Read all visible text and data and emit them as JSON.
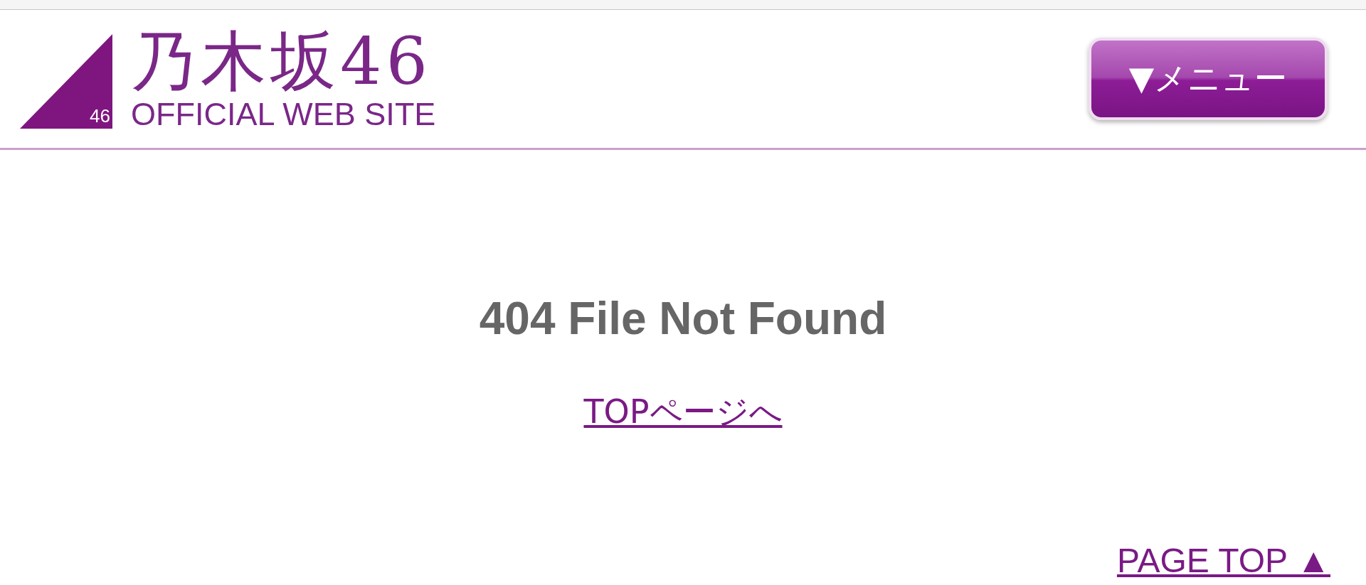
{
  "header": {
    "logo": {
      "badge": "46",
      "title": "乃木坂46",
      "subtitle": "OFFICIAL WEB SITE"
    },
    "menu_button": "▼メニュー"
  },
  "error": {
    "heading": "404 File Not Found",
    "link": "TOPページへ"
  },
  "page_top_link": "PAGE TOP ▲"
}
